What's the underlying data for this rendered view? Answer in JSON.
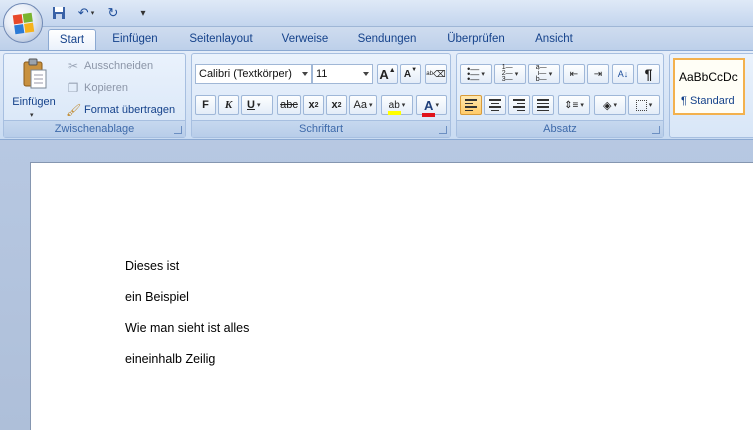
{
  "tabs": [
    "Start",
    "Einfügen",
    "Seitenlayout",
    "Verweise",
    "Sendungen",
    "Überprüfen",
    "Ansicht"
  ],
  "clipboard": {
    "paste_label": "Einfügen",
    "cut_label": "Ausschneiden",
    "copy_label": "Kopieren",
    "format_painter_label": "Format übertragen",
    "group_label": "Zwischenablage"
  },
  "font": {
    "family": "Calibri (Textkörper)",
    "size": "11",
    "group_label": "Schriftart",
    "bold": "F",
    "italic": "K",
    "underline": "U",
    "strike": "abc",
    "subscript": "x",
    "superscript": "x",
    "case": "Aa",
    "highlight": "ab",
    "color_letter": "A",
    "grow": "A",
    "shrink": "A"
  },
  "paragraph": {
    "group_label": "Absatz",
    "pilcrow": "¶"
  },
  "styles": {
    "preview": "AaBbCcDc",
    "name": "¶ Standard"
  },
  "document": {
    "lines": [
      "Dieses ist",
      "ein Beispiel",
      "Wie man sieht ist alles",
      "eineinhalb Zeilig"
    ]
  },
  "colors": {
    "highlight": "#ffff00",
    "font_color": "#e0131b",
    "accent_tab_text": "#15428b"
  }
}
